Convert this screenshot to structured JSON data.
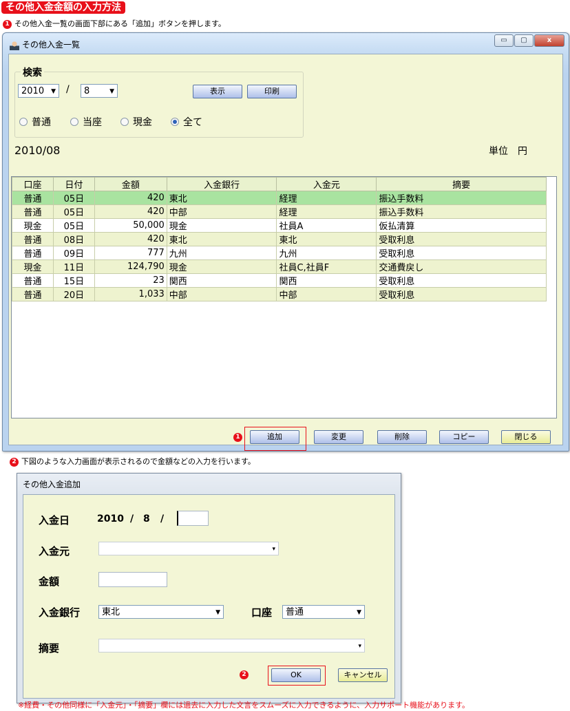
{
  "header": {
    "title": "その他入金金額の入力方法"
  },
  "steps": {
    "s1_num": "1",
    "s1_text": "その他入金一覧の画面下部にある「追加」ボタンを押します。",
    "s2_num": "2",
    "s2_text": "下図のような入力画面が表示されるので金額などの入力を行います。"
  },
  "list_window": {
    "title": "その他入金一覧",
    "controls": {
      "minimize": "▭",
      "maximize": "▢",
      "close": "x"
    },
    "search": {
      "legend": "検索",
      "year": "2010",
      "separator": "/",
      "month": "8",
      "show_button": "表示",
      "print_button": "印刷",
      "radios": [
        {
          "label": "普通",
          "checked": false
        },
        {
          "label": "当座",
          "checked": false
        },
        {
          "label": "現金",
          "checked": false
        },
        {
          "label": "全て",
          "checked": true
        }
      ]
    },
    "period": "2010/08",
    "unit": "単位　円",
    "table": {
      "headers": [
        "口座",
        "日付",
        "金額",
        "入金銀行",
        "入金元",
        "摘要"
      ],
      "rows": [
        [
          "普通",
          "05日",
          "420",
          "東北",
          "経理",
          "振込手数料"
        ],
        [
          "普通",
          "05日",
          "420",
          "中部",
          "経理",
          "振込手数料"
        ],
        [
          "現金",
          "05日",
          "50,000",
          "現金",
          "社員A",
          "仮払清算"
        ],
        [
          "普通",
          "08日",
          "420",
          "東北",
          "東北",
          "受取利息"
        ],
        [
          "普通",
          "09日",
          "777",
          "九州",
          "九州",
          "受取利息"
        ],
        [
          "現金",
          "11日",
          "124,790",
          "現金",
          "社員C,社員F",
          "交通費戻し"
        ],
        [
          "普通",
          "15日",
          "23",
          "関西",
          "関西",
          "受取利息"
        ],
        [
          "普通",
          "20日",
          "1,033",
          "中部",
          "中部",
          "受取利息"
        ]
      ]
    },
    "buttons": {
      "add": "追加",
      "edit": "変更",
      "delete": "削除",
      "copy": "コピー",
      "close": "閉じる"
    },
    "marker": "1"
  },
  "add_dialog": {
    "title": "その他入金追加",
    "date_label": "入金日",
    "year": "2010",
    "sep1": "/",
    "month": "8",
    "sep2": "/",
    "day": "",
    "source_label": "入金元",
    "source": "",
    "amount_label": "金額",
    "amount": "",
    "bank_label": "入金銀行",
    "bank": "東北",
    "account_label": "口座",
    "account": "普通",
    "summary_label": "摘要",
    "summary": "",
    "ok_button": "OK",
    "cancel_button": "キャンセル",
    "marker": "2"
  },
  "footnote": "※経費・その他同様に「入金元」・「摘要」欄には過去に入力した文言をスムーズに入力できるように、入力サポート機能があります。"
}
